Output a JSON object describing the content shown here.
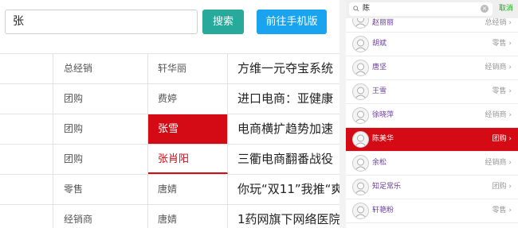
{
  "search": {
    "value": "张",
    "button": "搜索",
    "mobile_button": "前往手机版"
  },
  "table": {
    "rows": [
      {
        "role": "总经销",
        "name": "轩华丽",
        "title": "方维一元夺宝系统"
      },
      {
        "role": "团购",
        "name": "费婷",
        "title": "进口电商：亚健康"
      },
      {
        "role": "团购",
        "name": "张雪",
        "title": "电商横扩趋势加速"
      },
      {
        "role": "团购",
        "name": "张肖阳",
        "title": "三衢电商翻番战役"
      },
      {
        "role": "零售",
        "name": "唐婧",
        "title": "你玩“双11”我推“爽"
      },
      {
        "role": "经销商",
        "name": "唐婧",
        "title": "1药网旗下网络医院"
      }
    ]
  },
  "mobile": {
    "search_value": "陈",
    "cancel": "取消",
    "clear_glyph": "×",
    "items": [
      {
        "name": "赵丽丽",
        "tag": "总经销 ›"
      },
      {
        "name": "胡斌",
        "tag": "零售 ›"
      },
      {
        "name": "唐坚",
        "tag": "经销商 ›"
      },
      {
        "name": "王雪",
        "tag": "零售 ›"
      },
      {
        "name": "徐晓萍",
        "tag": "经销商 ›"
      },
      {
        "name": "陈美华",
        "tag": "团购 ›"
      },
      {
        "name": "余松",
        "tag": "经销商 ›"
      },
      {
        "name": "知足常乐",
        "tag": "团购 ›"
      },
      {
        "name": "轩艳粉",
        "tag": "零售 ›"
      }
    ]
  },
  "colors": {
    "highlight": "#d40b14",
    "search_btn": "#27a99b",
    "mobile_btn": "#1aa3ee",
    "name_purple": "#6b3e99"
  },
  "icons": {
    "search": "search-icon",
    "clear": "clear-icon",
    "avatar": "avatar-icon"
  }
}
